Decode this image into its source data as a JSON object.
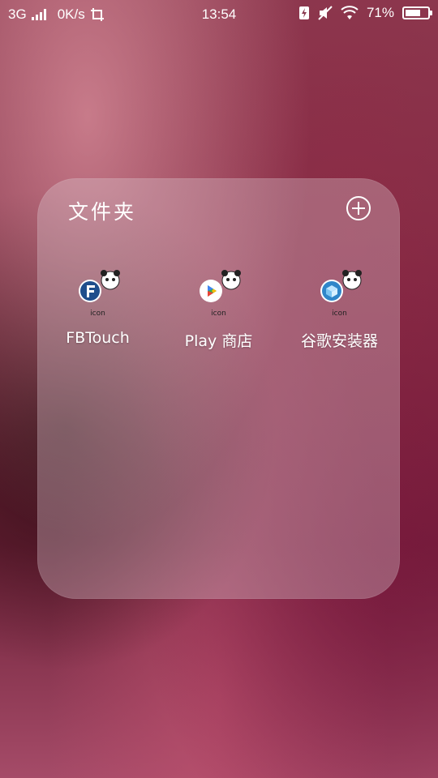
{
  "status_bar": {
    "network": "3G",
    "speed": "0K/s",
    "time": "13:54",
    "battery": "71%",
    "battery_level": 0.71
  },
  "folder": {
    "title": "文件夹",
    "apps": [
      {
        "label": "FBTouch",
        "icon": "fbtouch-icon",
        "caption": "icon"
      },
      {
        "label": "Play 商店",
        "icon": "play-store-icon",
        "caption": "icon"
      },
      {
        "label": "谷歌安装器",
        "icon": "google-installer-icon",
        "caption": "icon"
      }
    ]
  }
}
